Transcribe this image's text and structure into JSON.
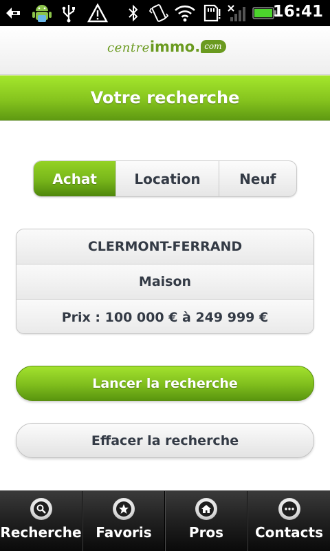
{
  "status_bar": {
    "time": "16:41",
    "icons": [
      "usb-debug-icon",
      "android-icon",
      "usb-icon",
      "warning-icon",
      "bluetooth-icon",
      "vibrate-icon",
      "wifi-icon",
      "sd-card-icon",
      "no-signal-icon",
      "battery-icon"
    ]
  },
  "header": {
    "logo_part1": "centre",
    "logo_part2": "immo",
    "logo_dot": ".",
    "logo_part3": "com"
  },
  "title": "Votre recherche",
  "segments": [
    {
      "label": "Achat",
      "selected": true
    },
    {
      "label": "Location",
      "selected": false
    },
    {
      "label": "Neuf",
      "selected": false
    }
  ],
  "criteria": {
    "city": "CLERMONT-FERRAND",
    "type": "Maison",
    "price": "Prix : 100 000 € à 249 999 €"
  },
  "buttons": {
    "search": "Lancer la recherche",
    "clear": "Effacer la recherche"
  },
  "tabs": [
    {
      "label": "Recherche",
      "icon": "search-icon"
    },
    {
      "label": "Favoris",
      "icon": "star-icon"
    },
    {
      "label": "Pros",
      "icon": "home-icon"
    },
    {
      "label": "Contacts",
      "icon": "more-icon"
    }
  ],
  "colors": {
    "accent_green": "#86c41e",
    "text_dark": "#333a45",
    "tabbar_bg": "#202020"
  }
}
